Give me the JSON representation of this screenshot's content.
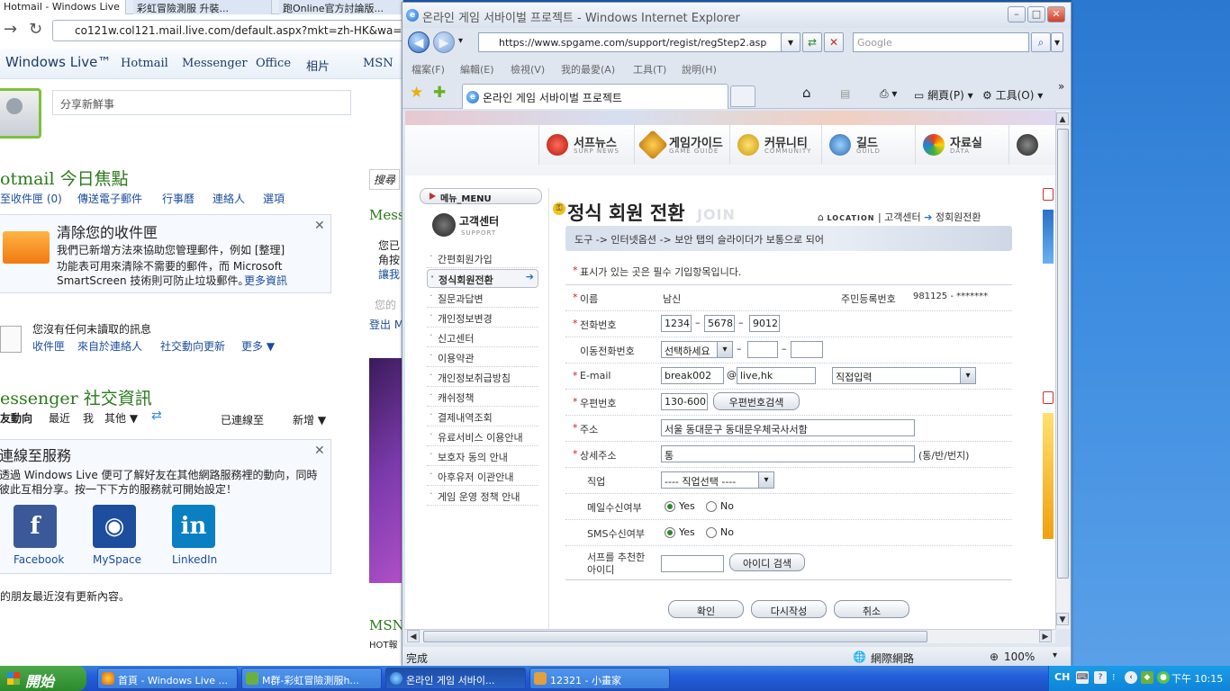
{
  "background_window": {
    "tabs": [
      "Hotmail - Windows Live",
      "彩虹冒險測服 升裝...",
      "跑Online官方討論版..."
    ],
    "address": "co121w.col121.mail.live.com/default.aspx?mkt=zh-HK&wa=ws",
    "brand": "Windows Live™",
    "nav": [
      "Hotmail",
      "Messenger",
      "Office",
      "相片",
      "MSN"
    ],
    "share_placeholder": "分享新鮮事",
    "today_title": "otmail 今日焦點",
    "today_links": [
      "至收件匣 (0)",
      "傳送電子郵件",
      "行事曆",
      "連絡人",
      "選項"
    ],
    "clean_title": "清除您的收件匣",
    "clean_body": [
      "我們已新增方法來協助您管理郵件，例如 [整理]",
      "功能表可用來清除不需要的郵件，而 Microsoft",
      "SmartScreen 技術則可防止垃圾郵件。"
    ],
    "clean_more": "更多資訊",
    "unread_text": "您沒有任何未讀取的訊息",
    "unread_links": [
      "收件匣",
      "來自於連絡人",
      "社交動向更新",
      "更多 ▼"
    ],
    "messenger_title": "essenger 社交資訊",
    "messenger_tabs": [
      "友動向",
      "最近",
      "我",
      "其他 ▼"
    ],
    "connected_to": "已連線至",
    "add": "新增 ▼",
    "connect_title": "連線至服務",
    "connect_body": [
      "透過 Windows Live 便可了解好友在其他網路服務裡的動向，同時",
      "彼此互相分享。按一下下方的服務就可開始設定！"
    ],
    "services": [
      "Facebook",
      "MySpace",
      "LinkedIn"
    ],
    "no_updates": "的朋友最近沒有更新內容。",
    "right_col": [
      "搜尋",
      "Mess",
      "您已",
      "角按",
      "讓我",
      "您的",
      "登出 M",
      "MSN",
      "HOT報"
    ]
  },
  "ie": {
    "title": "온라인 게임 서바이벌 프로젝트 - Windows Internet Explorer",
    "url": "https://www.spgame.com/support/regist/regStep2.asp",
    "search_placeholder": "Google",
    "menu": [
      "檔案(F)",
      "編輯(E)",
      "檢視(V)",
      "我的最愛(A)",
      "工具(T)",
      "說明(H)"
    ],
    "tab_title": "온라인 게임 서바이벌 프로젝트",
    "cmd": {
      "page": "網頁(P)",
      "tools": "工具(O)"
    },
    "status": "完成",
    "zone": "網際網路",
    "zoom": "100%"
  },
  "site": {
    "nav": [
      {
        "ko": "서프뉴스",
        "en": "SURP NEWS"
      },
      {
        "ko": "게임가이드",
        "en": "GAME GUIDE"
      },
      {
        "ko": "커뮤니티",
        "en": "COMMUNITY"
      },
      {
        "ko": "길드",
        "en": "GUILD"
      },
      {
        "ko": "자료실",
        "en": "DATA"
      }
    ],
    "menu_label": "메뉴_MENU",
    "support_ko": "고객센터",
    "support_en": "SUPPORT",
    "menu_items": [
      "간편회원가입",
      "정식회원전환",
      "질문과답변",
      "개인정보변경",
      "신고센터",
      "이용약관",
      "개인정보취급방침",
      "캐쉬정책",
      "결제내역조회",
      "유료서비스 이용안내",
      "보호자 동의 안내",
      "아후유저 이관안내",
      "게임 운영 정책 안내"
    ],
    "page_title": "정식 회원 전환",
    "page_title_en": "JOIN",
    "location": "LOCATION",
    "breadcrumb": [
      "고객센터",
      "정회원전환"
    ],
    "notice": "도구 -> 인터넷옵션 -> 보안 탭의 슬라이더가 보통으로 되어",
    "required_note": "표시가 있는 곳은 필수 기입항목입니다.",
    "form": {
      "name_label": "이름",
      "name_value": "남신",
      "rrn_label": "주민등록번호",
      "rrn_value": "981125 - *******",
      "phone_label": "전화번호",
      "phone": [
        "1234",
        "5678",
        "9012"
      ],
      "mobile_label": "이동전화번호",
      "mobile_select": "선택하세요",
      "mobile": [
        "",
        ""
      ],
      "email_label": "E-mail",
      "email_id": "break002",
      "email_domain": "live,hk",
      "email_select": "직접입력",
      "zip_label": "우편번호",
      "zip_value": "130-600",
      "zip_button": "우편번호검색",
      "addr_label": "주소",
      "addr_value": "서울 동대문구 동대문우체국사서함",
      "detail_label": "상세주소",
      "detail_value": "통",
      "detail_hint": "(통/반/번지)",
      "job_label": "직업",
      "job_select": "---- 직업선택 ----",
      "mail_label": "메일수신여부",
      "sms_label": "SMS수신여부",
      "yes": "Yes",
      "no": "No",
      "rec_label": [
        "서프를 추천한",
        "아이디"
      ],
      "rec_button": "아이디 검색"
    },
    "buttons": [
      "확인",
      "다시작성",
      "취소"
    ]
  },
  "taskbar": {
    "start": "開始",
    "tasks": [
      "首頁 - Windows Live ...",
      "M群-彩虹冒險測服h...",
      "온라인 게임 서바이...",
      "12321 - 小畫家"
    ],
    "lang": "CH",
    "clock": "下午 10:15"
  }
}
